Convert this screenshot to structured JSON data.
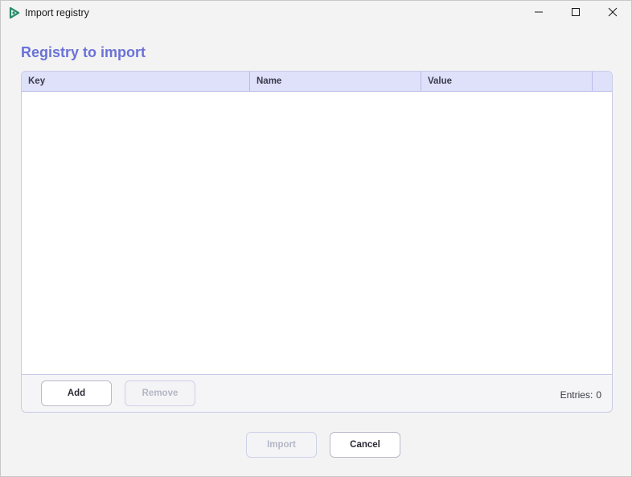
{
  "window": {
    "title": "Import registry",
    "icon": "app-logo-icon",
    "controls": [
      "minimize-icon",
      "maximize-icon",
      "close-icon"
    ]
  },
  "heading": "Registry to import",
  "table": {
    "columns": [
      "Key",
      "Name",
      "Value"
    ],
    "rows": []
  },
  "panel_buttons": {
    "add": "Add",
    "remove": "Remove"
  },
  "entries": {
    "label": "Entries:",
    "count": "0"
  },
  "footer_buttons": {
    "import": "Import",
    "cancel": "Cancel"
  },
  "colors": {
    "accent": "#6a72d6",
    "header_bg": "#dfe1fb",
    "icon_green": "#2a8c6c"
  }
}
